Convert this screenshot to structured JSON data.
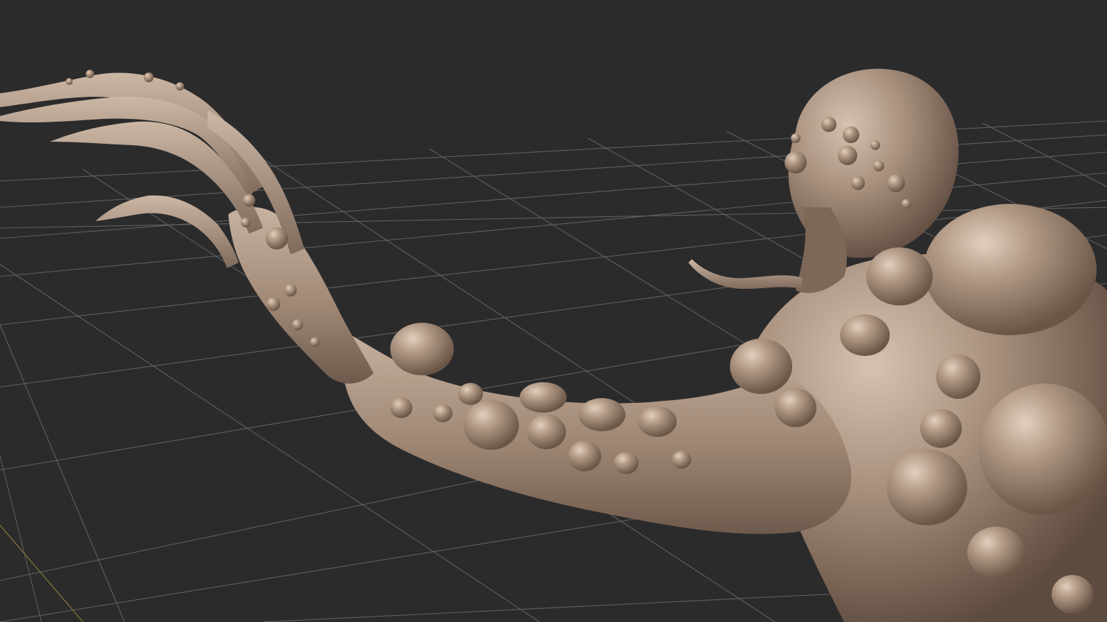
{
  "viewport": {
    "background_color": "#2b2b2c",
    "grid_color": "#6b6b6b",
    "axis_color": "#8a7a3a",
    "model_color": "#a8907d",
    "model_highlight_color": "#cdb8a6",
    "model_shadow_color": "#6e5a4c"
  },
  "scene": {
    "object": "sculpted-creature-mesh",
    "view": "perspective"
  }
}
